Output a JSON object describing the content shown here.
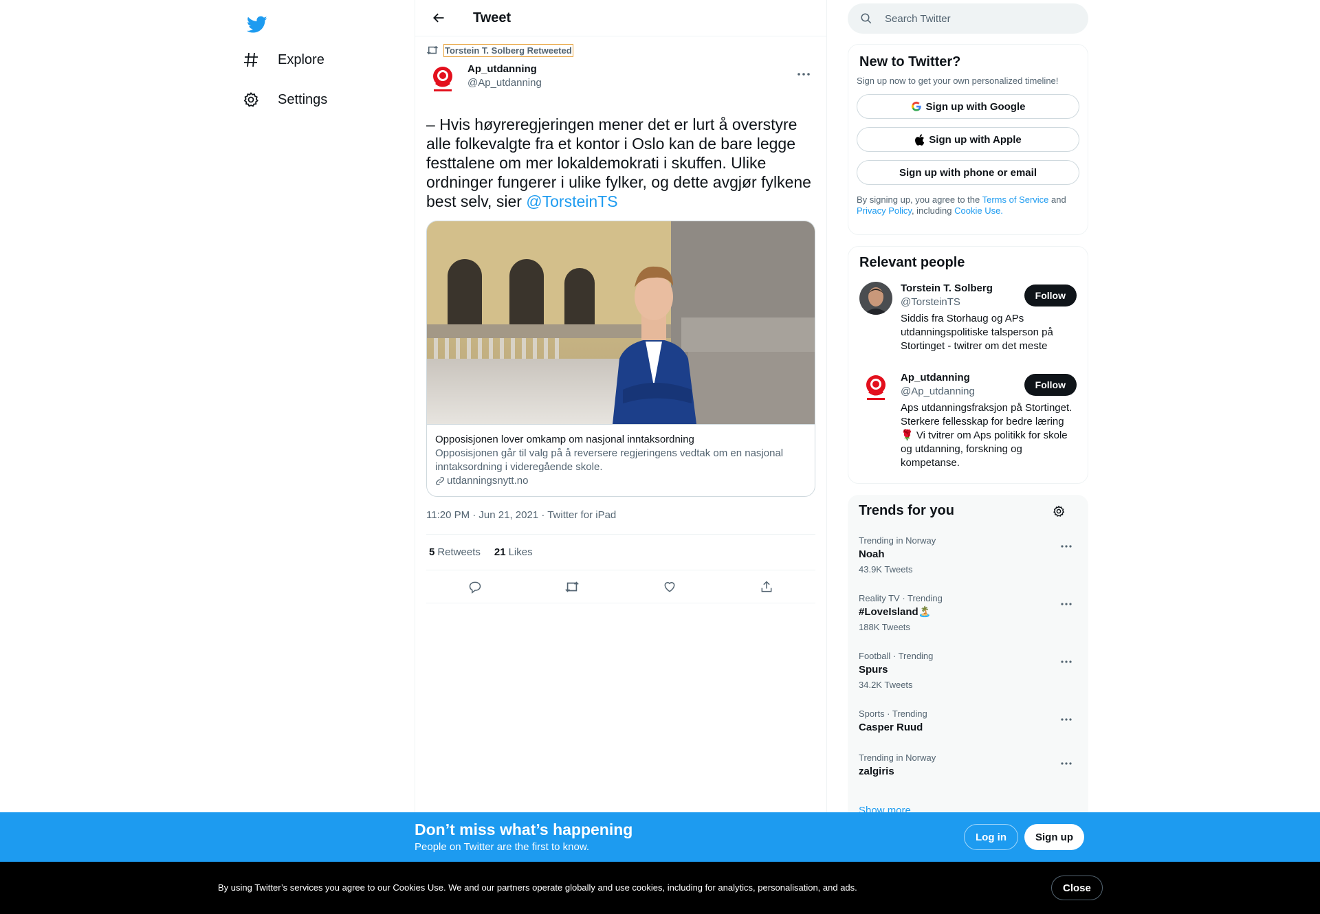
{
  "nav": {
    "logo": "twitter-bird",
    "items": [
      {
        "label": "Explore",
        "icon": "hashtag-icon"
      },
      {
        "label": "Settings",
        "icon": "gear-icon"
      }
    ]
  },
  "header": {
    "title": "Tweet"
  },
  "tweet": {
    "retweeted_by": "Torstein T. Solberg Retweeted",
    "author_name": "Ap_utdanning",
    "author_handle": "@Ap_utdanning",
    "text": "– Hvis høyreregjeringen mener det er lurt å overstyre alle folkevalgte fra et kontor i Oslo kan de bare legge festtalene om mer lokaldemokrati i skuffen. Ulike ordninger fungerer i ulike fylker, og dette avgjør fylkene best selv, sier ",
    "mention": "@TorsteinTS",
    "card": {
      "title": "Opposisjonen lover omkamp om nasjonal inntaksordning",
      "description": "Opposisjonen går til valg på å reversere regjeringens vedtak om en nasjonal inntaksordning i videregående skole.",
      "domain": "utdanningsnytt.no"
    },
    "timestamp": "11:20 PM · Jun 21, 2021 · Twitter for iPad",
    "retweets_count": "5",
    "retweets_label": "Retweets",
    "likes_count": "21",
    "likes_label": "Likes"
  },
  "search": {
    "placeholder": "Search Twitter"
  },
  "new_to_twitter": {
    "title": "New to Twitter?",
    "subtitle": "Sign up now to get your own personalized timeline!",
    "google": "Sign up with Google",
    "apple": "Sign up with Apple",
    "phone": "Sign up with phone or email",
    "terms_prefix": "By signing up, you agree to the ",
    "terms_link": "Terms of Service",
    "terms_and": " and",
    "privacy_link": "Privacy Policy",
    "terms_including": ", including ",
    "cookie_link": "Cookie Use."
  },
  "relevant": {
    "title": "Relevant people",
    "people": [
      {
        "name": "Torstein T. Solberg",
        "handle": "@TorsteinTS",
        "bio": "Siddis fra Storhaug og APs utdanningspolitiske talsperson på Stortinget - twitrer om det meste",
        "follow": "Follow"
      },
      {
        "name": "Ap_utdanning",
        "handle": "@Ap_utdanning",
        "bio": "Aps utdanningsfraksjon på Stortinget. Sterkere fellesskap for bedre læring 🌹 Vi tvitrer om Aps politikk for skole og utdanning, forskning og kompetanse.",
        "follow": "Follow"
      }
    ]
  },
  "trends": {
    "title": "Trends for you",
    "items": [
      {
        "context": "Trending in Norway",
        "name": "Noah",
        "count": "43.9K Tweets"
      },
      {
        "context": "Reality TV · Trending",
        "name": "#LoveIsland🏝️",
        "count": "188K Tweets"
      },
      {
        "context": "Football · Trending",
        "name": "Spurs",
        "count": "34.2K Tweets"
      },
      {
        "context": "Sports · Trending",
        "name": "Casper Ruud",
        "count": ""
      },
      {
        "context": "Trending in Norway",
        "name": "zalgiris",
        "count": ""
      }
    ],
    "show_more": "Show more"
  },
  "banner": {
    "title": "Don’t miss what’s happening",
    "subtitle": "People on Twitter are the first to know.",
    "login": "Log in",
    "signup": "Sign up"
  },
  "cookie": {
    "text": "By using Twitter’s services you agree to our Cookies Use. We and our partners operate globally and use cookies, including for analytics, personalisation, and ads.",
    "close": "Close"
  },
  "colors": {
    "accent": "#1d9bf0",
    "text": "#0f1419",
    "secondary": "#536471",
    "border": "#eff3f4"
  }
}
